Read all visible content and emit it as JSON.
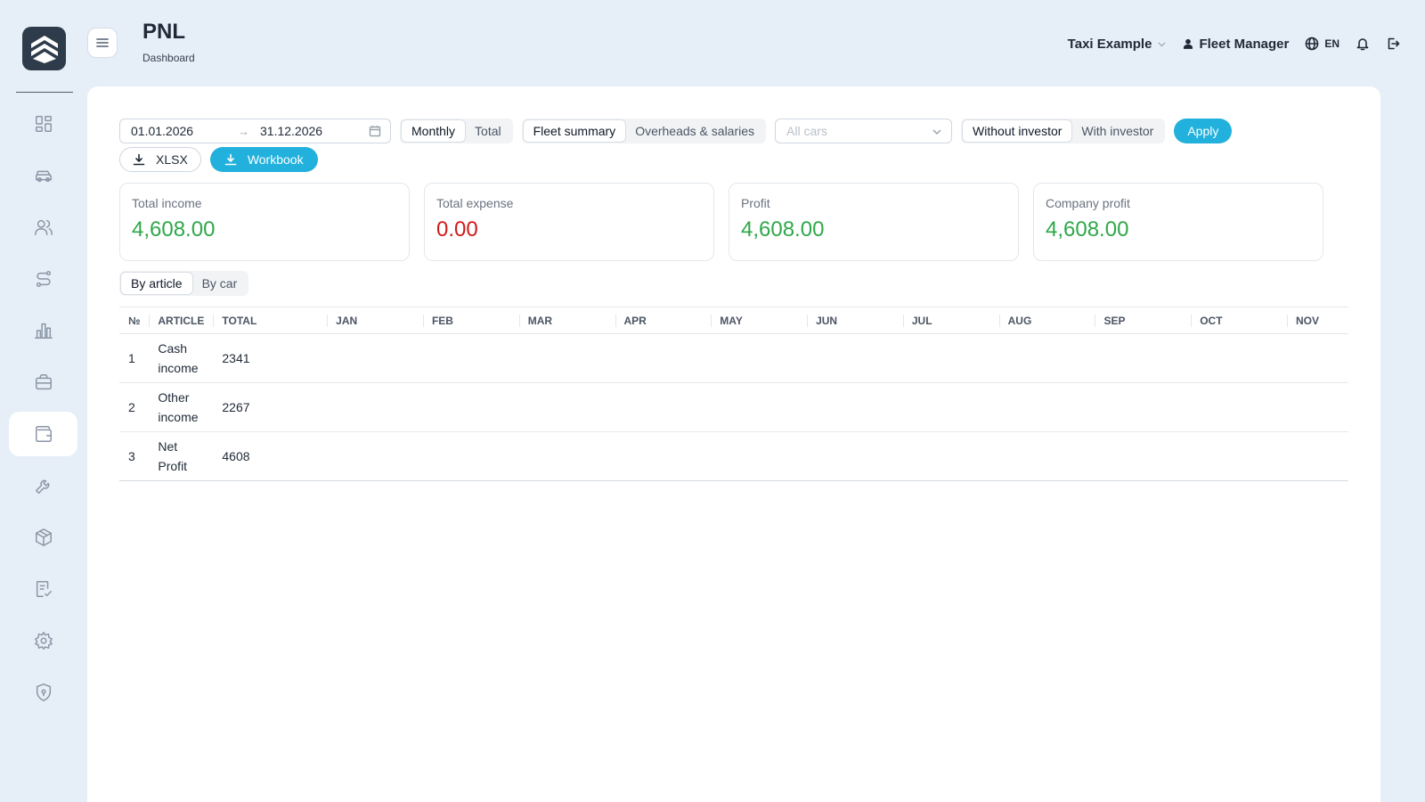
{
  "header": {
    "title": "PNL",
    "subtitle": "Dashboard",
    "company": "Taxi Example",
    "user": "Fleet Manager",
    "language": "EN"
  },
  "sidebar": {
    "items": [
      {
        "icon": "dashboard-icon",
        "active": false
      },
      {
        "icon": "car-icon",
        "active": false
      },
      {
        "icon": "users-icon",
        "active": false
      },
      {
        "icon": "route-icon",
        "active": false
      },
      {
        "icon": "chart-icon",
        "active": false
      },
      {
        "icon": "briefcase-icon",
        "active": false
      },
      {
        "icon": "wallet-icon",
        "active": true
      },
      {
        "icon": "wrench-icon",
        "active": false
      },
      {
        "icon": "box-icon",
        "active": false
      },
      {
        "icon": "checklist-icon",
        "active": false
      },
      {
        "icon": "gear-icon",
        "active": false
      },
      {
        "icon": "shield-icon",
        "active": false
      }
    ]
  },
  "filters": {
    "date_from": "01.01.2026",
    "date_to": "31.12.2026",
    "period": {
      "options": [
        "Monthly",
        "Total"
      ],
      "selected": "Monthly"
    },
    "view": {
      "options": [
        "Fleet summary",
        "Overheads & salaries"
      ],
      "selected": "Fleet summary"
    },
    "cars_placeholder": "All cars",
    "investor": {
      "options": [
        "Without investor",
        "With investor"
      ],
      "selected": "Without investor"
    },
    "apply_label": "Apply"
  },
  "exports": {
    "xlsx_label": "XLSX",
    "workbook_label": "Workbook"
  },
  "stats": [
    {
      "label": "Total income",
      "value": "4,608.00",
      "color": "#2ea84a"
    },
    {
      "label": "Total expense",
      "value": "0.00",
      "color": "#d01a1a"
    },
    {
      "label": "Profit",
      "value": "4,608.00",
      "color": "#2ea84a"
    },
    {
      "label": "Company profit",
      "value": "4,608.00",
      "color": "#2ea84a"
    }
  ],
  "tabs": {
    "options": [
      "By article",
      "By car"
    ],
    "selected": "By article"
  },
  "table": {
    "columns": [
      "№",
      "ARTICLE",
      "TOTAL",
      "JAN",
      "FEB",
      "MAR",
      "APR",
      "MAY",
      "JUN",
      "JUL",
      "AUG",
      "SEP",
      "OCT",
      "NOV"
    ],
    "rows": [
      {
        "no": "1",
        "article": "Cash income",
        "total": "2341"
      },
      {
        "no": "2",
        "article": "Other income",
        "total": "2267"
      },
      {
        "no": "3",
        "article": "Net Profit",
        "total": "4608"
      }
    ]
  },
  "colors": {
    "accent": "#22b1dd",
    "background": "#e6eef7",
    "positive": "#2ea84a",
    "negative": "#d01a1a"
  }
}
